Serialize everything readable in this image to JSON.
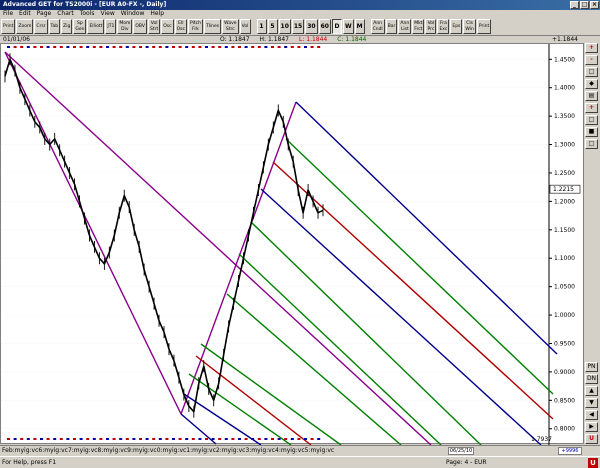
{
  "window": {
    "title": "Advanced GET for TS2000i - [EUR A0-FX -, Daily]"
  },
  "menu": [
    "File",
    "Edit",
    "Page",
    "Chart",
    "Tools",
    "View",
    "Window",
    "Help"
  ],
  "toolbar": {
    "left": [
      "Print",
      "Zoom",
      "Crsr",
      "Tab",
      "Zig",
      "Sp\nGen",
      "Elliott",
      "JT1",
      "Mom\nDiv",
      "OBV",
      "Vol\nStrt",
      "Osc",
      "Ell\nOsc",
      "Pitch\nFrk",
      "Tlines",
      "Wave\nStrc",
      "Vol"
    ],
    "timeframes": [
      "1",
      "5",
      "10",
      "15",
      "30",
      "60",
      "D",
      "W",
      "M"
    ],
    "active_timeframe": "D",
    "right": [
      "Ann\nCndl",
      "Bar",
      "Ann\nList",
      "Mkt\nFrct",
      "Vol\nPrc",
      "Fra\nExc",
      "Eps",
      "Cls\nWin",
      "Print"
    ]
  },
  "info": {
    "date": "01/01/06",
    "open": "O: 1.1847",
    "high": "H: 1.1847",
    "low": "L: 1.1844",
    "close": "C: 1.1844",
    "last_price": "+1.1844"
  },
  "chart_data": {
    "type": "line",
    "ylim": [
      0.7714,
      1.4769
    ],
    "yticks": [
      "1.4500",
      "1.4000",
      "1.3500",
      "1.3000",
      "1.2500",
      "1.2000",
      "1.1500",
      "1.1000",
      "1.0500",
      "1.0000",
      "0.9500",
      "0.9000",
      "0.8500",
      "0.8000"
    ],
    "ytick_values": [
      1.45,
      1.4,
      1.35,
      1.3,
      1.25,
      1.2,
      1.15,
      1.1,
      1.05,
      1.0,
      0.95,
      0.9,
      0.85,
      0.8
    ],
    "current_price_label": "1.2215",
    "current_price": 1.2215,
    "low_label": "1.7937",
    "series": [
      {
        "values": [
          1.42,
          1.45,
          1.43,
          1.4,
          1.38,
          1.36,
          1.34,
          1.33,
          1.31,
          1.3,
          1.31,
          1.29,
          1.27,
          1.25,
          1.23,
          1.2,
          1.17,
          1.14,
          1.12,
          1.1,
          1.09,
          1.11,
          1.14,
          1.18,
          1.21,
          1.19,
          1.15,
          1.12,
          1.08,
          1.05,
          1.02,
          0.99,
          0.97,
          0.94,
          0.92,
          0.89,
          0.86,
          0.84,
          0.83,
          0.88,
          0.91,
          0.87,
          0.85,
          0.88,
          0.93,
          0.98,
          1.02,
          1.06,
          1.1,
          1.14,
          1.18,
          1.22,
          1.26,
          1.3,
          1.33,
          1.36,
          1.34,
          1.3,
          1.27,
          1.22,
          1.18,
          1.22,
          1.2,
          1.18,
          1.1844
        ]
      }
    ],
    "pitchfork_colors": [
      "#8b008b",
      "#b00000",
      "#008000",
      "#00008b"
    ]
  },
  "tabs": "Feb:myig:vc6:myig:vc7:myig:vc8:myig:vc9:myig:vc0:myig:vc1:myig:vc2:myig:vc3:myig:vc4:myig:vc5:myig:vc",
  "date_box": "06/25/10",
  "zoom_box": "+9996",
  "status": {
    "help": "For Help, press F1",
    "page": "Page: 4 - EUR"
  },
  "right_tools": [
    "+",
    "-",
    "□",
    "◆",
    "▤",
    "+",
    "□",
    "■",
    "□"
  ],
  "right_tools_bottom": [
    "PN",
    "DN",
    "▲",
    "▼",
    "◀",
    "▶",
    "U"
  ]
}
